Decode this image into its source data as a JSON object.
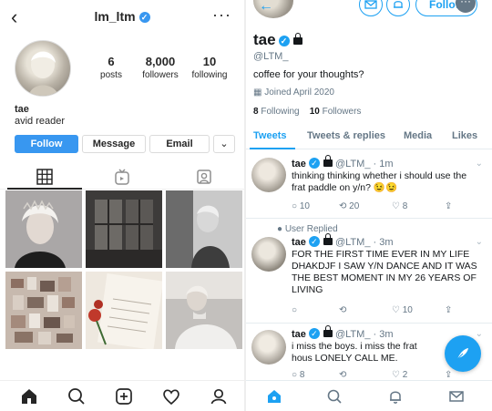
{
  "instagram": {
    "username": "lm_ltm",
    "verified_mark": "✓",
    "more": "···",
    "back": "‹",
    "stats": [
      {
        "num": "6",
        "label": "posts"
      },
      {
        "num": "8,000",
        "label": "followers"
      },
      {
        "num": "10",
        "label": "following"
      }
    ],
    "name": "tae",
    "bio": "avid reader",
    "buttons": {
      "follow": "Follow",
      "message": "Message",
      "email": "Email",
      "dropdown": "⌄"
    },
    "tabs": [
      "grid-icon",
      "igtv-icon",
      "tagged-icon"
    ],
    "nav": [
      "home-icon",
      "search-icon",
      "new-post-icon",
      "heart-icon",
      "profile-icon"
    ]
  },
  "twitter": {
    "back": "←",
    "follow_label": "Follow",
    "overflow": "···",
    "name": "tae",
    "handle": "@LTM_",
    "bio": "coffee for your thoughts?",
    "joined": "Joined April 2020",
    "following_count": "8",
    "following_label": "Following",
    "followers_count": "10",
    "followers_label": "Followers",
    "tabs": [
      "Tweets",
      "Tweets & replies",
      "Media",
      "Likes"
    ],
    "tweets": [
      {
        "name": "tae",
        "meta": "@LTM_ · 1m",
        "text": "thinking thinking whether i should use the frat paddle on y/n? 😉😉",
        "replies": "10",
        "retweets": "20",
        "likes": "8",
        "replied": ""
      },
      {
        "name": "tae",
        "meta": "@LTM_ · 3m",
        "text": "FOR THE FIRST TIME EVER IN MY LIFE DHAKDJF I SAW Y/N DANCE AND IT WAS THE BEST MOMENT IN MY 26 YEARS OF LIVING",
        "replies": "",
        "retweets": "",
        "likes": "10",
        "replied": "User Replied"
      },
      {
        "name": "tae",
        "meta": "@LTM_ · 3m",
        "text": "i miss the boys. i miss the frat hous LONELY CALL ME.",
        "replies": "8",
        "retweets": "",
        "likes": "2",
        "replied": ""
      }
    ],
    "nav": [
      "home-icon",
      "search-icon",
      "notifications-icon",
      "messages-icon"
    ],
    "accent": "#1da1f2"
  }
}
